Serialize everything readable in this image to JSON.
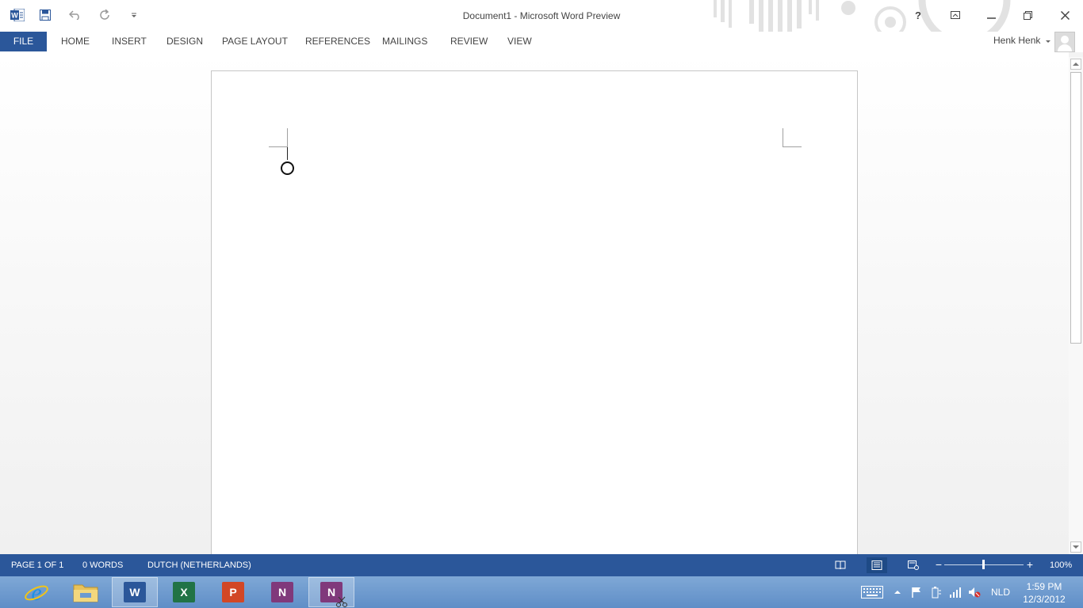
{
  "titlebar": {
    "title": "Document1 - Microsoft Word Preview",
    "qat": [
      "word-app-icon",
      "save-icon",
      "undo-icon",
      "redo-icon",
      "customize-qat-icon"
    ],
    "help_label": "?"
  },
  "ribbon": {
    "tabs": [
      {
        "label": "FILE"
      },
      {
        "label": "HOME"
      },
      {
        "label": "INSERT"
      },
      {
        "label": "DESIGN"
      },
      {
        "label": "PAGE LAYOUT"
      },
      {
        "label": "REFERENCES"
      },
      {
        "label": "MAILINGS"
      },
      {
        "label": "REVIEW"
      },
      {
        "label": "VIEW"
      }
    ],
    "user_name": "Henk Henk"
  },
  "statusbar": {
    "page": "PAGE 1 OF 1",
    "words": "0 WORDS",
    "language": "DUTCH (NETHERLANDS)",
    "zoom_label": "100%",
    "zoom_level": 100,
    "minus": "−",
    "plus": "+"
  },
  "taskbar": {
    "apps": [
      {
        "name": "internet-explorer",
        "label": "e"
      },
      {
        "name": "file-explorer",
        "label": ""
      },
      {
        "name": "word",
        "label": "W"
      },
      {
        "name": "excel",
        "label": "X"
      },
      {
        "name": "powerpoint",
        "label": "P"
      },
      {
        "name": "onenote",
        "label": "N"
      },
      {
        "name": "onenote-clipping",
        "label": "N"
      }
    ],
    "language": "NLD",
    "time": "1:59 PM",
    "date": "12/3/2012"
  },
  "colors": {
    "word_blue": "#2b579a",
    "excel_green": "#217346",
    "powerpoint_orange": "#d24726",
    "onenote_purple": "#80397b"
  }
}
